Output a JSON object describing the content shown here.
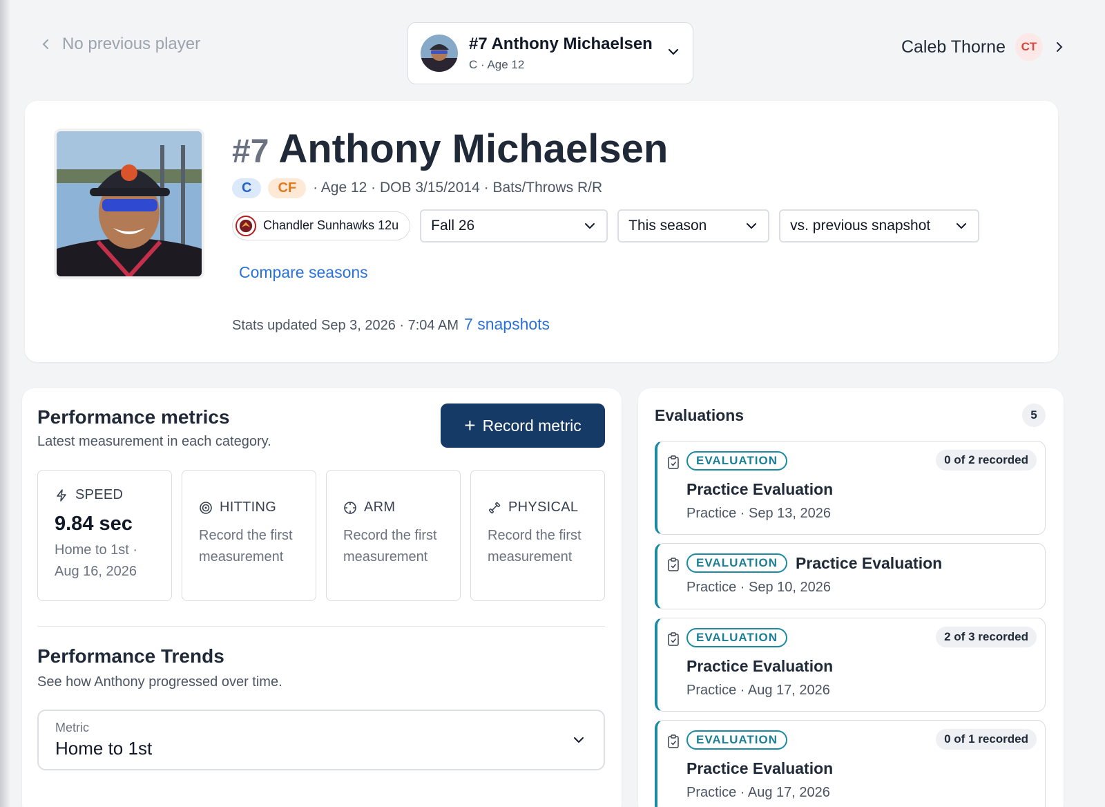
{
  "nav": {
    "prev_label": "No previous player",
    "current": {
      "name": "#7 Anthony Michaelsen",
      "sub": "C · Age 12"
    },
    "next_name": "Caleb Thorne",
    "next_initials": "CT"
  },
  "player": {
    "number": "#7",
    "name": "Anthony Michaelsen",
    "positions": [
      "C",
      "CF"
    ],
    "meta": "· Age 12 · DOB 3/15/2014 · Bats/Throws R/R",
    "team": "Chandler Sunhawks 12u",
    "season_select": "Fall 26",
    "range_select": "This season",
    "compare_select": "vs. previous snapshot",
    "compare_link": "Compare seasons",
    "updated_text": "Stats updated Sep 3, 2026 · 7:04 AM",
    "snapshots_link": "7 snapshots"
  },
  "metrics": {
    "title": "Performance metrics",
    "subtitle": "Latest measurement in each category.",
    "record_button": "Record metric",
    "tiles": [
      {
        "category": "SPEED",
        "value": "9.84 sec",
        "desc": "Home to 1st · Aug 16, 2026",
        "icon": "bolt-icon"
      },
      {
        "category": "HITTING",
        "desc": "Record the first measurement",
        "icon": "target-icon"
      },
      {
        "category": "ARM",
        "desc": "Record the first measurement",
        "icon": "crosshair-icon"
      },
      {
        "category": "PHYSICAL",
        "desc": "Record the first measurement",
        "icon": "dumbbell-icon"
      }
    ],
    "trends_title": "Performance Trends",
    "trends_sub": "See how Anthony progressed over time.",
    "metric_label": "Metric",
    "metric_value": "Home to 1st"
  },
  "evaluations": {
    "title": "Evaluations",
    "count": "5",
    "items": [
      {
        "tag": "EVALUATION",
        "recorded": "0 of 2 recorded",
        "name": "Practice Evaluation",
        "sub": "Practice · Sep 13, 2026"
      },
      {
        "tag": "EVALUATION",
        "name": "Practice Evaluation",
        "sub": "Practice · Sep 10, 2026"
      },
      {
        "tag": "EVALUATION",
        "recorded": "2 of 3 recorded",
        "name": "Practice Evaluation",
        "sub": "Practice · Aug 17, 2026"
      },
      {
        "tag": "EVALUATION",
        "recorded": "0 of 1 recorded",
        "name": "Practice Evaluation",
        "sub": "Practice · Aug 17, 2026"
      }
    ]
  },
  "colors": {
    "accent": "#153a66",
    "link": "#2a72d8",
    "teal": "#1a8aa3",
    "ct_badge": "#d9463b"
  }
}
